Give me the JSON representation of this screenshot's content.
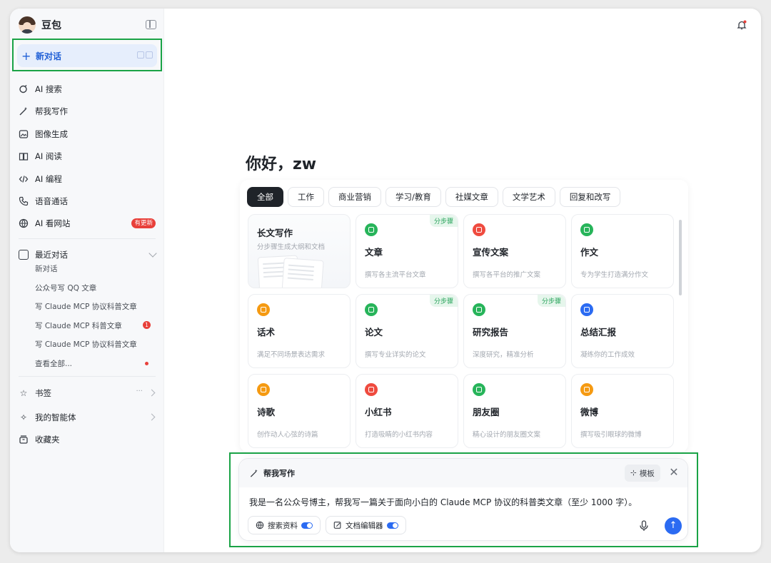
{
  "app": {
    "name": "豆包"
  },
  "sidebar": {
    "new_chat": "新对话",
    "items": [
      {
        "label": "AI 搜索",
        "icon": "ai-search-icon"
      },
      {
        "label": "帮我写作",
        "icon": "writing-wand-icon"
      },
      {
        "label": "图像生成",
        "icon": "image-generation-icon"
      },
      {
        "label": "AI 阅读",
        "icon": "reading-book-icon"
      },
      {
        "label": "AI 编程",
        "icon": "code-icon"
      },
      {
        "label": "语音通话",
        "icon": "phone-icon"
      },
      {
        "label": "AI 看网站",
        "icon": "globe-ai-icon",
        "badge": "有更新"
      }
    ],
    "recent": {
      "title": "最近对话",
      "items": [
        {
          "label": "新对话"
        },
        {
          "label": "公众号写 QQ 文章"
        },
        {
          "label": "写 Claude MCP 协议科普文章"
        },
        {
          "label": "写 Claude MCP 科普文章",
          "badge": "1"
        },
        {
          "label": "写 Claude MCP 协议科普文章"
        },
        {
          "label": "查看全部..."
        }
      ]
    },
    "bottom": [
      {
        "label": "书签",
        "icon": "star-icon",
        "extra": "···"
      },
      {
        "label": "我的智能体",
        "icon": "sparkle-icon"
      },
      {
        "label": "收藏夹",
        "icon": "archive-box-icon"
      }
    ]
  },
  "main": {
    "greeting": "你好，zw",
    "tabs": [
      "全部",
      "工作",
      "商业营销",
      "学习/教育",
      "社媒文章",
      "文学艺术",
      "回复和改写"
    ],
    "active_tab": "全部",
    "cards": [
      {
        "title": "长文写作",
        "desc": "分步骤生成大纲和文档",
        "featured": true
      },
      {
        "title": "文章",
        "desc": "撰写各主流平台文章",
        "color": "#27b45a",
        "step": "分步骤"
      },
      {
        "title": "宣传文案",
        "desc": "撰写各平台的推广文案",
        "color": "#ef4b3f"
      },
      {
        "title": "作文",
        "desc": "专为学生打造满分作文",
        "color": "#27b45a"
      },
      {
        "title": "话术",
        "desc": "满足不同场景表达需求",
        "color": "#f59a12"
      },
      {
        "title": "论文",
        "desc": "撰写专业详实的论文",
        "color": "#27b45a",
        "step": "分步骤"
      },
      {
        "title": "研究报告",
        "desc": "深度研究，精准分析",
        "color": "#27b45a",
        "step": "分步骤"
      },
      {
        "title": "总结汇报",
        "desc": "凝练你的工作成效",
        "color": "#2b6bf2"
      },
      {
        "title": "诗歌",
        "desc": "创作动人心弦的诗篇",
        "color": "#f59a12"
      },
      {
        "title": "小红书",
        "desc": "打造吸睛的小红书内容",
        "color": "#ef4b3f"
      },
      {
        "title": "朋友圈",
        "desc": "精心设计的朋友圈文案",
        "color": "#27b45a"
      },
      {
        "title": "微博",
        "desc": "撰写吸引眼球的微博",
        "color": "#f59a12"
      }
    ]
  },
  "composer": {
    "mode": "帮我写作",
    "template": "模板",
    "text": "我是一名公众号博主，帮我写一篇关于面向小白的 Claude MCP 协议的科普类文章（至少 1000 字）。",
    "chips": [
      {
        "label": "搜索资料",
        "icon": "globe-icon",
        "enabled": true
      },
      {
        "label": "文档编辑器",
        "icon": "edit-doc-icon",
        "enabled": true
      }
    ]
  },
  "colors": {
    "accent": "#2b6bf2",
    "highlight_frame": "#1aa346",
    "badge_red": "#e8403a"
  }
}
